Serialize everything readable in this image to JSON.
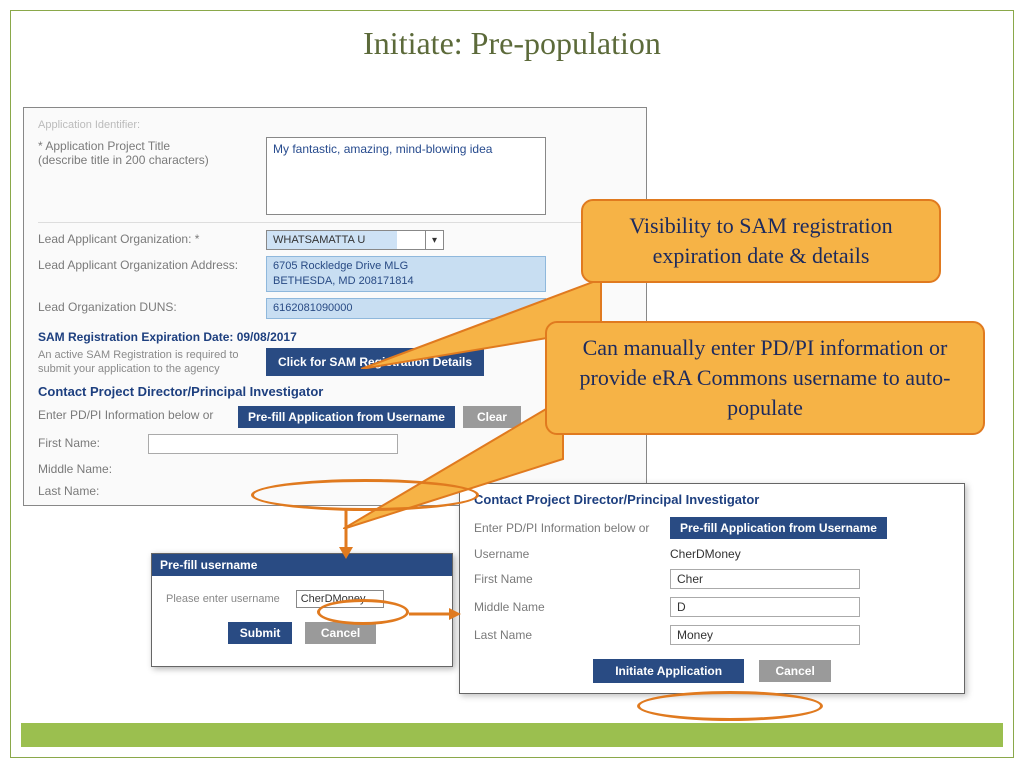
{
  "title": "Initiate: Pre-population",
  "form": {
    "app_identifier_label": "Application Identifier:",
    "proj_title_label": "* Application Project Title\n  (describe title in 200 characters)",
    "proj_title_value": "My fantastic, amazing, mind-blowing idea",
    "lead_org_label": "Lead Applicant Organization: *",
    "lead_org_value": "WHATSAMATTA U",
    "lead_addr_label": "Lead Applicant Organization Address:",
    "lead_addr_value": "6705 Rockledge Drive MLG\nBETHESDA, MD 208171814",
    "lead_duns_label": "Lead Organization DUNS:",
    "lead_duns_value": "6162081090000",
    "sam_label": "SAM Registration Expiration Date:",
    "sam_date": "09/08/2017",
    "sam_note": "An active SAM Registration is required to submit your application to the agency",
    "sam_btn": "Click for SAM Registration Details",
    "pdpi_heading": "Contact Project Director/Principal Investigator",
    "pdpi_instr": "Enter PD/PI Information below or",
    "prefill_btn": "Pre-fill Application from Username",
    "clear_btn": "Clear",
    "fn_label": "First Name:",
    "mn_label": "Middle Name:",
    "ln_label": "Last Name:"
  },
  "prefill_popup": {
    "header": "Pre-fill username",
    "label": "Please enter username",
    "value": "CherDMoney",
    "submit": "Submit",
    "cancel": "Cancel"
  },
  "panel2": {
    "heading": "Contact Project Director/Principal Investigator",
    "instr": "Enter PD/PI Information below or",
    "prefill_btn": "Pre-fill Application from Username",
    "un_label": "Username",
    "un_value": "CherDMoney",
    "fn_label": "First Name",
    "fn_value": "Cher",
    "mn_label": "Middle Name",
    "mn_value": "D",
    "ln_label": "Last Name",
    "ln_value": "Money",
    "initiate_btn": "Initiate Application",
    "cancel": "Cancel"
  },
  "callouts": {
    "c1": "Visibility to SAM registration expiration date & details",
    "c2": "Can manually enter PD/PI information or provide eRA Commons username to auto-populate"
  }
}
